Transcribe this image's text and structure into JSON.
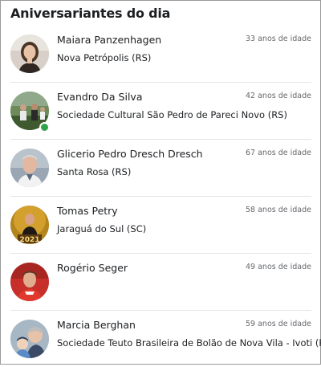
{
  "title": "Aniversariantes do dia",
  "people": [
    {
      "name": "Maiara Panzenhagen",
      "age": "33 anos de idade",
      "location": "Nova Petrópolis (RS)",
      "online": false
    },
    {
      "name": "Evandro Da Silva",
      "age": "42 anos de idade",
      "location": "Sociedade Cultural São Pedro de Pareci Novo (RS)",
      "online": true
    },
    {
      "name": "Glicerio Pedro Dresch Dresch",
      "age": "67 anos de idade",
      "location": "Santa Rosa (RS)",
      "online": false
    },
    {
      "name": "Tomas Petry",
      "age": "58 anos de idade",
      "location": "Jaraguá do Sul (SC)",
      "online": false
    },
    {
      "name": "Rogério Seger",
      "age": "49 anos de idade",
      "location": "",
      "online": false
    },
    {
      "name": "Marcia Berghan",
      "age": "59 anos de idade",
      "location": "Sociedade Teuto Brasileira de Bolão de Nova Vila - Ivoti (RS)",
      "online": false
    }
  ],
  "badge_text": "2021",
  "colors": {
    "online": "#31a24c",
    "text": "#1c1e21",
    "muted": "#65676b",
    "divider": "#e4e6eb"
  }
}
